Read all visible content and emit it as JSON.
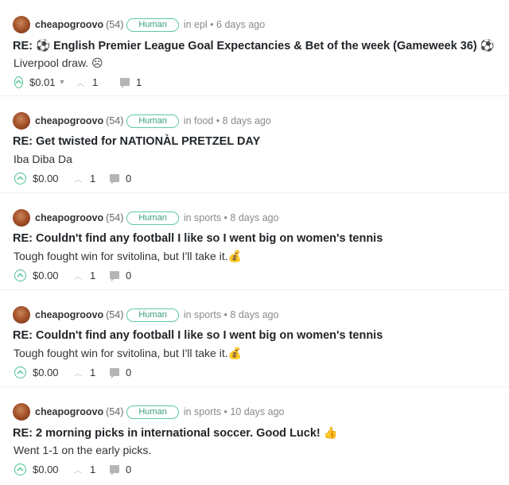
{
  "colors": {
    "accent": "#4cc492",
    "badge": "#5fc9a1"
  },
  "posts": [
    {
      "author": "cheapogroovo",
      "reputation": "(54)",
      "badge": "Human",
      "meta": "in epl • 6 days ago",
      "title": "RE: ⚽ English Premier League Goal Expectancies & Bet of the week (Gameweek 36) ⚽",
      "body": "Liverpool draw. ☹",
      "payout": "$0.01",
      "has_caret": true,
      "votes": "1",
      "comments": "1"
    },
    {
      "author": "cheapogroovo",
      "reputation": "(54)",
      "badge": "Human",
      "meta": "in food • 8 days ago",
      "title": "RE: Get twisted for NATIONÀL PRETZEL DAY",
      "body": "Iba Diba Da",
      "payout": "$0.00",
      "has_caret": false,
      "votes": "1",
      "comments": "0"
    },
    {
      "author": "cheapogroovo",
      "reputation": "(54)",
      "badge": "Human",
      "meta": "in sports • 8 days ago",
      "title": "RE: Couldn't find any football I like so I went big on women's tennis",
      "body": "Tough fought win for svitolina, but I'll take it.💰",
      "payout": "$0.00",
      "has_caret": false,
      "votes": "1",
      "comments": "0"
    },
    {
      "author": "cheapogroovo",
      "reputation": "(54)",
      "badge": "Human",
      "meta": "in sports • 8 days ago",
      "title": "RE: Couldn't find any football I like so I went big on women's tennis",
      "body": "Tough fought win for svitolina, but I'll take it.💰",
      "payout": "$0.00",
      "has_caret": false,
      "votes": "1",
      "comments": "0"
    },
    {
      "author": "cheapogroovo",
      "reputation": "(54)",
      "badge": "Human",
      "meta": "in sports • 10 days ago",
      "title": "RE: 2 morning picks in international soccer. Good Luck! 👍",
      "body": "Went 1-1 on the early picks.",
      "payout": "$0.00",
      "has_caret": false,
      "votes": "1",
      "comments": "0"
    }
  ]
}
